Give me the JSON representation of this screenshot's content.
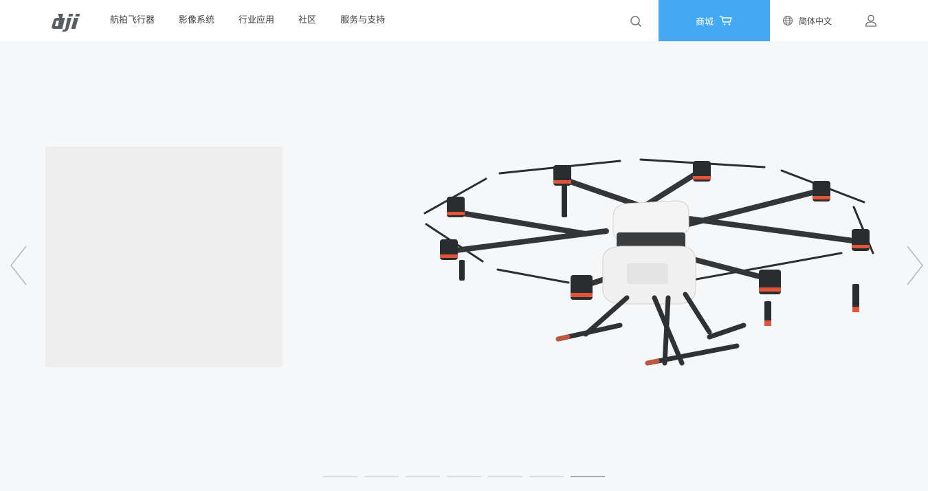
{
  "header": {
    "logo_text": "dji",
    "nav": [
      {
        "label": "航拍飞行器"
      },
      {
        "label": "影像系统"
      },
      {
        "label": "行业应用"
      },
      {
        "label": "社区"
      },
      {
        "label": "服务与支持"
      }
    ],
    "store_label": "商城",
    "language_label": "简体中文",
    "icons": {
      "search": "search-icon",
      "cart": "cart-icon",
      "globe": "globe-icon",
      "user": "user-icon"
    },
    "colors": {
      "store_bg": "#44a8f2",
      "header_bg": "#ffffff"
    }
  },
  "hero": {
    "background": "#f6f7f9",
    "image": "agricultural-octocopter-drone",
    "slides_total": 7,
    "active_slide": 7
  }
}
